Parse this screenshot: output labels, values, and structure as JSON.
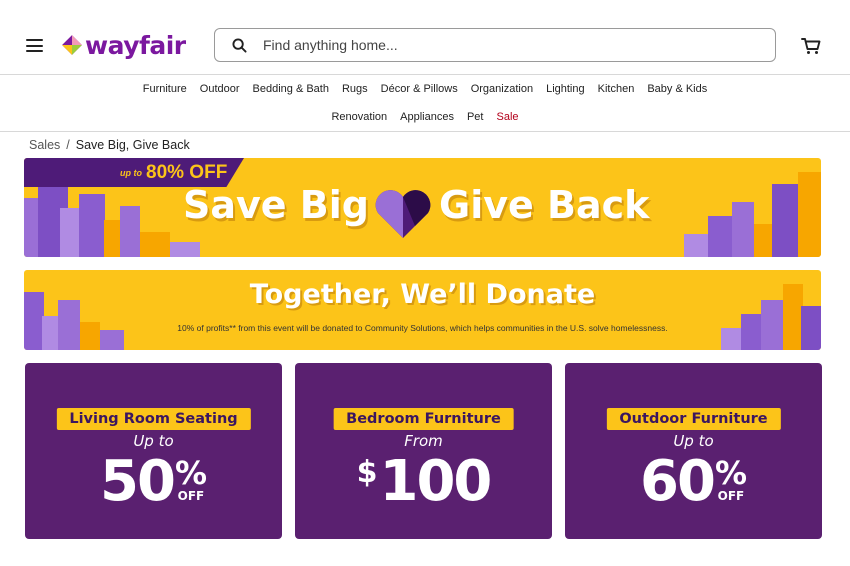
{
  "header": {
    "logo_text": "wayfair",
    "search_placeholder": "Find anything home...",
    "icons": {
      "menu": "hamburger-menu-icon",
      "search": "search-icon",
      "cart": "cart-icon"
    },
    "brand_color": "#7b189f"
  },
  "nav": {
    "row1": [
      "Furniture",
      "Outdoor",
      "Bedding & Bath",
      "Rugs",
      "Décor & Pillows",
      "Organization",
      "Lighting",
      "Kitchen",
      "Baby & Kids"
    ],
    "row2": [
      "Renovation",
      "Appliances",
      "Pet"
    ],
    "sale": "Sale",
    "sale_color": "#b3001b"
  },
  "breadcrumb": {
    "parent": "Sales",
    "separator": "/",
    "current": "Save Big, Give Back"
  },
  "hero": {
    "tag_small": "up to",
    "tag_big": "80% OFF",
    "title_left": "Save Big",
    "title_right": "Give Back",
    "accent": "#fcc419",
    "purple": "#4e1b78"
  },
  "donate": {
    "title": "Together, We’ll Donate",
    "note": "10% of profits** from this event will be donated to Community Solutions, which helps communities in the U.S. solve homelessness."
  },
  "cards": [
    {
      "label": "Living Room Seating",
      "prefix": "Up to",
      "currency": "",
      "amount": "50",
      "percent": "%",
      "suffix": "OFF"
    },
    {
      "label": "Bedroom Furniture",
      "prefix": "From",
      "currency": "$",
      "amount": "100",
      "percent": "",
      "suffix": ""
    },
    {
      "label": "Outdoor Furniture",
      "prefix": "Up to",
      "currency": "",
      "amount": "60",
      "percent": "%",
      "suffix": "OFF"
    }
  ]
}
